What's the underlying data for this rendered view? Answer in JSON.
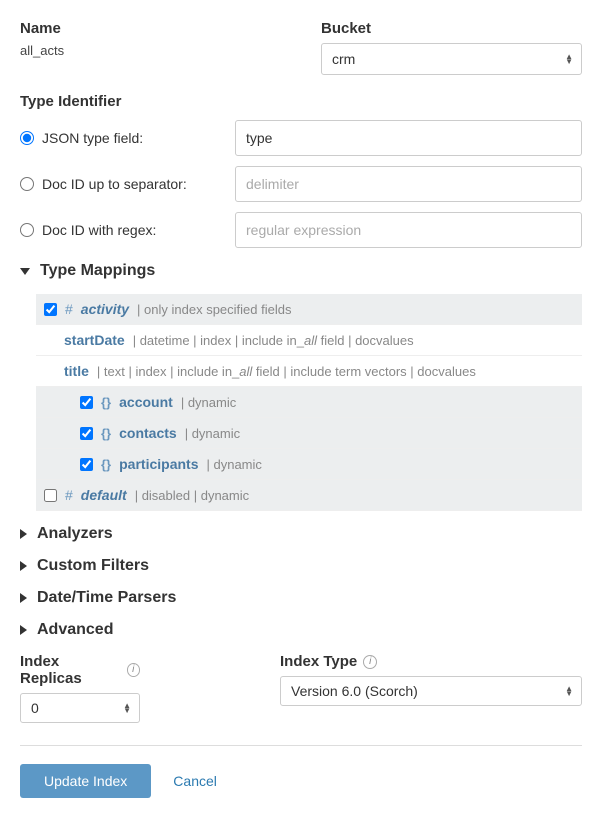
{
  "header": {
    "name_label": "Name",
    "name_value": "all_acts",
    "bucket_label": "Bucket",
    "bucket_value": "crm"
  },
  "type_identifier": {
    "heading": "Type Identifier",
    "json_field_label": "JSON type field:",
    "json_field_value": "type",
    "doc_id_sep_label": "Doc ID up to separator:",
    "doc_id_sep_placeholder": "delimiter",
    "doc_id_regex_label": "Doc ID with regex:",
    "doc_id_regex_placeholder": "regular expression"
  },
  "type_mappings": {
    "heading": "Type Mappings",
    "activity": {
      "name": "activity",
      "props": "only index specified fields",
      "startDate": {
        "name": "startDate",
        "props_before": "datetime | index | include in_",
        "props_all": "all",
        "props_after": " field | docvalues"
      },
      "title": {
        "name": "title",
        "props_before": "text | index | include in_",
        "props_all": "all",
        "props_after": " field | include term vectors | docvalues"
      },
      "account": {
        "name": "account",
        "props": "dynamic"
      },
      "contacts": {
        "name": "contacts",
        "props": "dynamic"
      },
      "participants": {
        "name": "participants",
        "props": "dynamic"
      }
    },
    "default": {
      "name": "default",
      "props": "disabled | dynamic"
    }
  },
  "sections": {
    "analyzers": "Analyzers",
    "custom_filters": "Custom Filters",
    "datetime_parsers": "Date/Time Parsers",
    "advanced": "Advanced"
  },
  "replicas": {
    "label": "Index Replicas",
    "value": "0"
  },
  "index_type": {
    "label": "Index Type",
    "value": "Version 6.0 (Scorch)"
  },
  "actions": {
    "update": "Update Index",
    "cancel": "Cancel"
  }
}
